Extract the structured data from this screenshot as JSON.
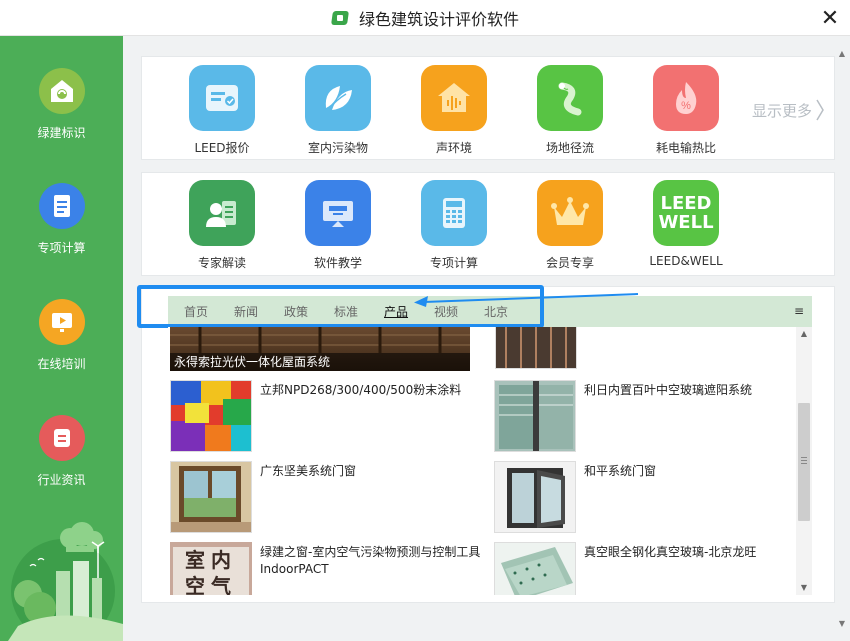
{
  "window": {
    "title": "绿色建筑设计评价软件",
    "close_glyph": "✕"
  },
  "sidebar": {
    "items": [
      {
        "label": "绿建标识",
        "icon": "green-building-logo-icon",
        "color": "#8cc04a"
      },
      {
        "label": "专项计算",
        "icon": "document-icon",
        "color": "#3b82e8"
      },
      {
        "label": "在线培训",
        "icon": "play-screen-icon",
        "color": "#f5a623"
      },
      {
        "label": "行业资讯",
        "icon": "news-icon",
        "color": "#e55b5b"
      }
    ]
  },
  "row1": {
    "tiles": [
      {
        "label": "LEED报价",
        "icon": "id-card-icon",
        "color": "#5ab9e8"
      },
      {
        "label": "室内污染物",
        "icon": "leaf-icon",
        "color": "#5ab9e8"
      },
      {
        "label": "声环境",
        "icon": "sound-wave-house-icon",
        "color": "#f6a21d"
      },
      {
        "label": "场地径流",
        "icon": "runoff-path-icon",
        "color": "#58c444"
      },
      {
        "label": "耗电输热比",
        "icon": "flame-percent-icon",
        "color": "#f27171"
      }
    ],
    "more_label": "显示更多"
  },
  "row2": {
    "tiles": [
      {
        "label": "专家解读",
        "icon": "expert-icon",
        "color": "#3fa35a"
      },
      {
        "label": "软件教学",
        "icon": "monitor-icon",
        "color": "#3b82e8"
      },
      {
        "label": "专项计算",
        "icon": "calculator-icon",
        "color": "#5ab9e8"
      },
      {
        "label": "会员专享",
        "icon": "crown-icon",
        "color": "#f6a21d"
      },
      {
        "label": "LEED&WELL",
        "icon": "leed-well-icon",
        "color": "#58c444",
        "badge_top": "LEED",
        "badge_bottom": "WELL"
      }
    ]
  },
  "tabs": [
    "首页",
    "新闻",
    "政策",
    "标准",
    "产品",
    "视频",
    "北京"
  ],
  "active_tab": "产品",
  "tab_menu_glyph": "≡",
  "products": {
    "banner_caption": "永得索拉光伏一体化屋面系统",
    "items": [
      {
        "title": "立邦NPD268/300/400/500粉末涂料"
      },
      {
        "title": "利日内置百叶中空玻璃遮阳系统"
      },
      {
        "title": "广东坚美系统门窗"
      },
      {
        "title": "和平系统门窗"
      },
      {
        "title": "绿建之窗-室内空气污染物预测与控制工具IndoorPACT",
        "thumb_text": "室内空气"
      },
      {
        "title": "真空眼全钢化真空玻璃-北京龙旺"
      }
    ]
  },
  "colors": {
    "sidebar": "#4cae57",
    "tab_bar": "#d3e8d5",
    "annotation": "#1f8cf0"
  }
}
